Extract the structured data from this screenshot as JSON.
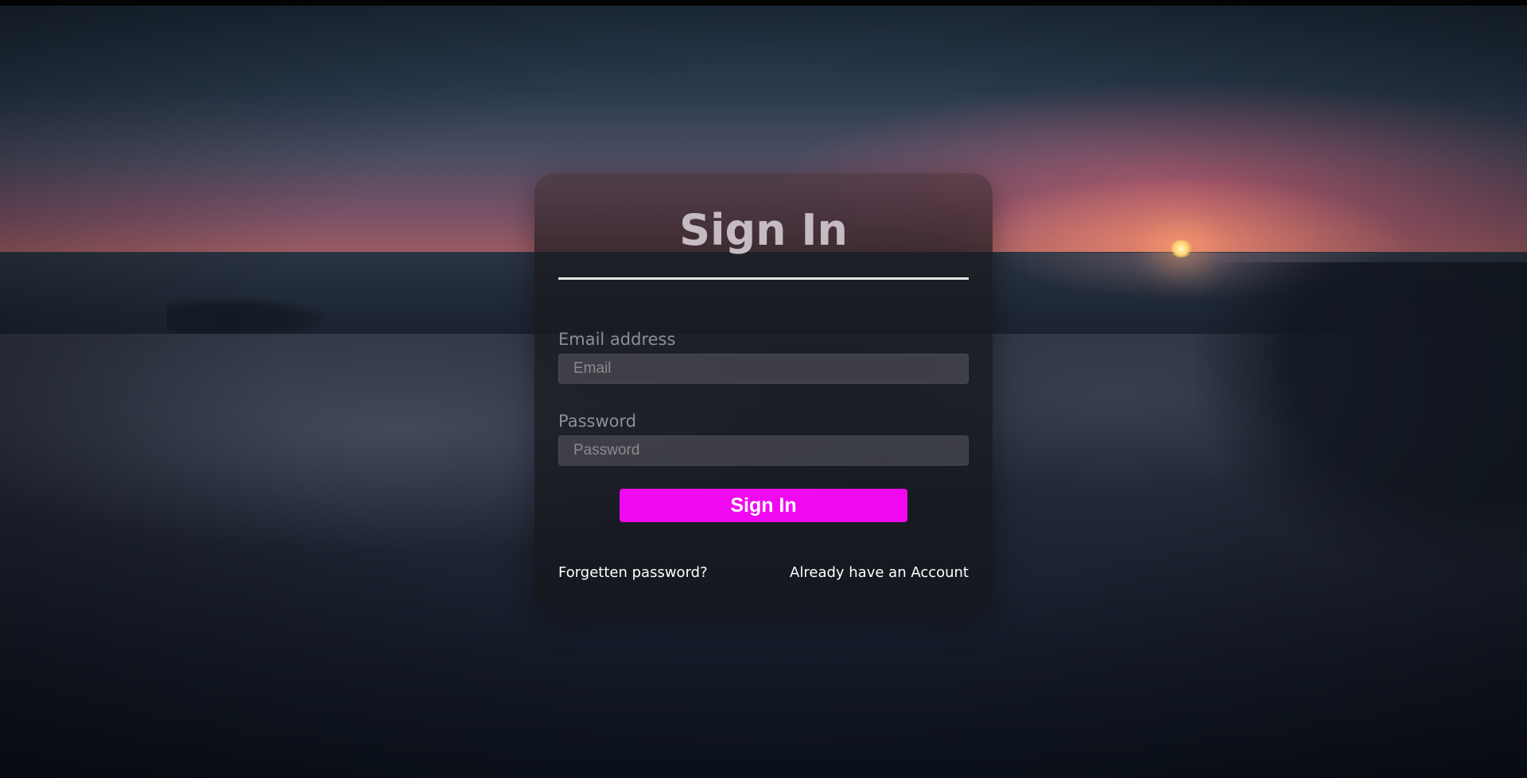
{
  "signin_form": {
    "title": "Sign In",
    "email": {
      "label": "Email address",
      "placeholder": "Email",
      "value": ""
    },
    "password": {
      "label": "Password",
      "placeholder": "Password",
      "value": ""
    },
    "submit_label": "Sign In",
    "forgot_password_link": "Forgetten password?",
    "account_link": "Already have an Account"
  },
  "colors": {
    "accent": "#f008f0",
    "title_text": "#c4bcc2",
    "label_text": "#8e8e93",
    "link_text": "#ffffff"
  }
}
